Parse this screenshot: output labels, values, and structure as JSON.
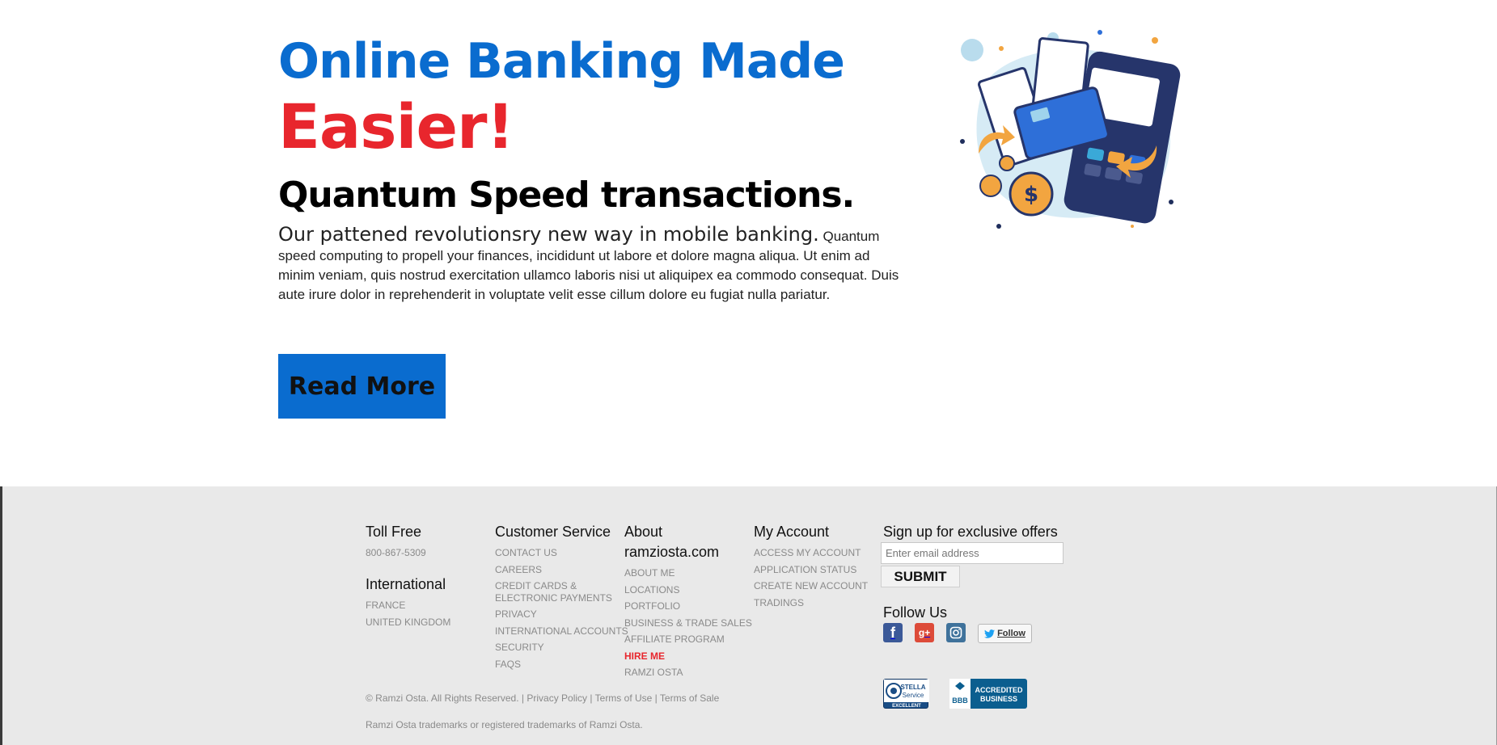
{
  "hero": {
    "headline_line1": "Online Banking Made",
    "headline_line2": "Easier!",
    "subheadline": "Quantum Speed transactions.",
    "paragraph_lead": "Our pattened revolutionsry new way in mobile banking.",
    "paragraph_body": " Quantum speed computing to propell your finances, incididunt ut labore et dolore magna aliqua. Ut enim ad minim veniam, quis nostrud exercitation ullamco laboris nisi ut aliquipex ea commodo consequat. Duis aute irure dolor in reprehenderit in voluptate velit esse cillum dolore eu fugiat nulla pariatur.",
    "cta_label": "Read More",
    "illustration_icon": "banking-illustration"
  },
  "footer": {
    "toll_free": {
      "heading": "Toll Free",
      "phone": "800-867-5309"
    },
    "international": {
      "heading": "International",
      "links": [
        "FRANCE",
        "UNITED KINGDOM"
      ]
    },
    "customer_service": {
      "heading": "Customer Service",
      "links": [
        "CONTACT US",
        "CAREERS",
        "CREDIT CARDS & ELECTRONIC PAYMENTS",
        "PRIVACY",
        "INTERNATIONAL ACCOUNTS",
        "SECURITY",
        "FAQS"
      ]
    },
    "about": {
      "heading": "About ramziosta.com",
      "links": [
        "ABOUT ME",
        "LOCATIONS",
        "PORTFOLIO",
        "BUSINESS & TRADE SALES",
        "AFFILIATE PROGRAM",
        "HIRE ME",
        "RAMZI OSTA"
      ]
    },
    "my_account": {
      "heading": "My Account",
      "links": [
        "ACCESS MY ACCOUNT",
        "APPLICATION STATUS",
        "CREATE NEW ACCOUNT",
        "TRADINGS"
      ]
    },
    "signup": {
      "heading": "Sign up for exclusive offers",
      "email_placeholder": "Enter email address",
      "email_value": "",
      "submit_label": "SUBMIT"
    },
    "follow": {
      "heading": "Follow Us",
      "icons": [
        "facebook-icon",
        "google-plus-icon",
        "instagram-icon",
        "twitter-icon"
      ],
      "twitter_label": "Follow"
    },
    "legal": {
      "copyright": "© Ramzi Osta. All Rights Reserved.",
      "sep": " | ",
      "privacy": "Privacy Policy",
      "terms_use": "Terms of Use",
      "terms_sale": "Terms of Sale",
      "trademark": "Ramzi Osta trademarks or registered trademarks of Ramzi Osta."
    },
    "badges": {
      "stella_line1": "STELLA",
      "stella_line2": "Service",
      "stella_line3": "EXCELLENT",
      "bbb_mark": "BBB",
      "bbb_line1": "ACCREDITED",
      "bbb_line2": "BUSINESS"
    }
  },
  "colors": {
    "brand_blue": "#0a6ccf",
    "brand_red": "#e8262d",
    "footer_bg": "#e9e9e9",
    "facebook": "#3b5998",
    "google_plus": "#dd4b39",
    "instagram": "#3f729b",
    "twitter": "#1da1f2",
    "bbb_blue": "#0b5e8f"
  }
}
